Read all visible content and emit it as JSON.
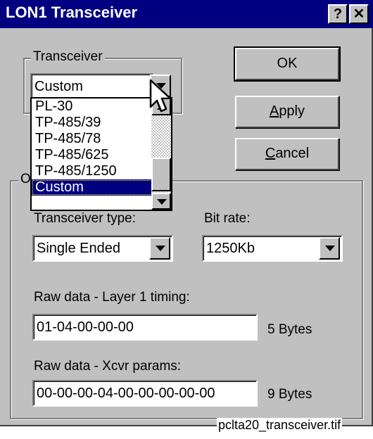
{
  "window": {
    "title": "LON1 Transceiver",
    "help_label": "?",
    "close_label": "✕"
  },
  "transceiver_group": {
    "label": "Transceiver",
    "selected": "Custom",
    "options": [
      "PL-30",
      "TP-485/39",
      "TP-485/78",
      "TP-485/625",
      "TP-485/1250",
      "Custom"
    ]
  },
  "buttons": {
    "ok": "OK",
    "apply_accel": "A",
    "apply_rest": "pply",
    "cancel_accel": "C",
    "cancel_rest": "ancel"
  },
  "params_group": {
    "label_fragment": "O",
    "transceiver_type_label": "Transceiver type:",
    "transceiver_type_value": "Single Ended",
    "bit_rate_label": "Bit rate:",
    "bit_rate_value": "1250Kb",
    "layer1_label": "Raw data - Layer 1 timing:",
    "layer1_value": "01-04-00-00-00",
    "layer1_size": "5 Bytes",
    "xcvr_label": "Raw data - Xcvr params:",
    "xcvr_value": "00-00-00-04-00-00-00-00-00",
    "xcvr_size": "9 Bytes"
  },
  "caption": "pclta20_transceiver.tif"
}
